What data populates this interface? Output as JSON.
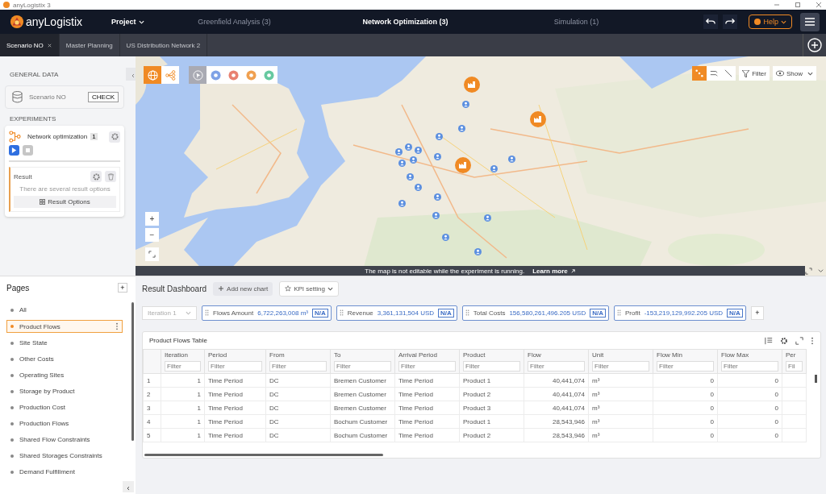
{
  "window": {
    "title": "anyLogistix 3"
  },
  "app": {
    "logo": "anyLogistix",
    "menu": "Project",
    "help": "Help"
  },
  "experiment_tabs": [
    {
      "label": "Greenfield Analysis (3)",
      "selected": false
    },
    {
      "label": "Network Optimization (3)",
      "selected": true
    },
    {
      "label": "Simulation (1)",
      "selected": false
    }
  ],
  "scenario_tabs": [
    {
      "label": "Scenario NO",
      "selected": true
    },
    {
      "label": "Master Planning",
      "selected": false
    },
    {
      "label": "US Distribution Network 2",
      "selected": false
    }
  ],
  "left_panel": {
    "general_heading": "GENERAL DATA",
    "scenario": "Scenario NO",
    "check": "CHECK",
    "experiments_heading": "EXPERIMENTS",
    "experiment": {
      "name": "Network optimization",
      "count": "1",
      "running": true
    },
    "result": {
      "title": "Result",
      "hint": "There are several result options",
      "button": "Result Options"
    }
  },
  "map": {
    "filter": "Filter",
    "show": "Show",
    "banner": "The map is not editable while the experiment is running.",
    "learn_more": "Learn more",
    "zoom_in": "+",
    "zoom_out": "−"
  },
  "pages": {
    "title": "Pages",
    "add": "+",
    "items": [
      {
        "label": "All",
        "selected": false
      },
      {
        "label": "Product Flows",
        "selected": true
      },
      {
        "label": "Site State",
        "selected": false
      },
      {
        "label": "Other Costs",
        "selected": false
      },
      {
        "label": "Operating Sites",
        "selected": false
      },
      {
        "label": "Storage by Product",
        "selected": false
      },
      {
        "label": "Production Cost",
        "selected": false
      },
      {
        "label": "Production Flows",
        "selected": false
      },
      {
        "label": "Shared Flow Constraints",
        "selected": false
      },
      {
        "label": "Shared Storages Constraints",
        "selected": false
      },
      {
        "label": "Demand Fulfillment",
        "selected": false
      }
    ]
  },
  "dashboard": {
    "title": "Result Dashboard",
    "add_chart": "Add new chart",
    "kpi_setting": "KPI setting",
    "iteration": {
      "value": "Iteration 1",
      "disabled": true
    },
    "kpis": [
      {
        "label": "Flows Amount",
        "value": "6,722,263,008 m³",
        "badge": "N/A"
      },
      {
        "label": "Revenue",
        "value": "3,361,131,504 USD",
        "badge": "N/A"
      },
      {
        "label": "Total Costs",
        "value": "156,580,261,496.205 USD",
        "badge": "N/A"
      },
      {
        "label": "Profit",
        "value": "-153,219,129,992.205 USD",
        "badge": "N/A"
      }
    ],
    "add_kpi": "+"
  },
  "table": {
    "title": "Product Flows Table",
    "columns": [
      {
        "label": "Iteration",
        "placeholder": "Filter"
      },
      {
        "label": "Period",
        "placeholder": "Filter"
      },
      {
        "label": "From",
        "placeholder": "Filter"
      },
      {
        "label": "To",
        "placeholder": "Filter"
      },
      {
        "label": "Arrival Period",
        "placeholder": "Filter"
      },
      {
        "label": "Product",
        "placeholder": "Filter"
      },
      {
        "label": "Flow",
        "placeholder": "Filter"
      },
      {
        "label": "Unit",
        "placeholder": "Filter"
      },
      {
        "label": "Flow Min",
        "placeholder": "Filter"
      },
      {
        "label": "Flow Max",
        "placeholder": "Filter"
      },
      {
        "label": "Per",
        "placeholder": "Fil"
      }
    ],
    "rows": [
      {
        "index": "1",
        "cells": [
          "1",
          "Time Period",
          "DC",
          "Bremen Customer",
          "Time Period",
          "Product 1",
          "40,441,074",
          "m³",
          "0",
          "0"
        ]
      },
      {
        "index": "2",
        "cells": [
          "1",
          "Time Period",
          "DC",
          "Bremen Customer",
          "Time Period",
          "Product 2",
          "40,441,074",
          "m³",
          "0",
          "0"
        ]
      },
      {
        "index": "3",
        "cells": [
          "1",
          "Time Period",
          "DC",
          "Bremen Customer",
          "Time Period",
          "Product 3",
          "40,441,074",
          "m³",
          "0",
          "0"
        ]
      },
      {
        "index": "4",
        "cells": [
          "1",
          "Time Period",
          "DC",
          "Bochum Customer",
          "Time Period",
          "Product 1",
          "28,543,946",
          "m³",
          "0",
          "0"
        ]
      },
      {
        "index": "5",
        "cells": [
          "1",
          "Time Period",
          "DC",
          "Bochum Customer",
          "Time Period",
          "Product 2",
          "28,543,946",
          "m³",
          "0",
          "0"
        ]
      }
    ]
  }
}
